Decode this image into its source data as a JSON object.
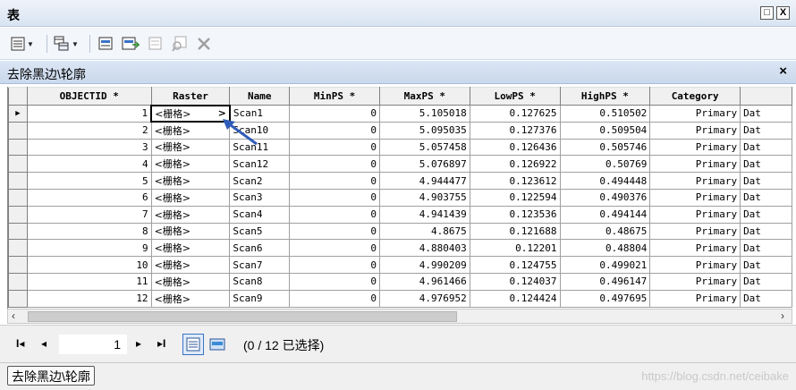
{
  "window": {
    "title": "表",
    "restore_glyph": "□",
    "close_glyph": "X"
  },
  "toolbar": {
    "buttons": [
      "table-options-icon",
      "related-tables-icon",
      "select-by-attributes-icon",
      "switch-selection-icon",
      "clear-selection-icon",
      "zoom-to-selected-icon",
      "delete-selected-icon"
    ]
  },
  "layer_tab": {
    "title": "去除黑边\\轮廓",
    "close_glyph": "×"
  },
  "table": {
    "columns": [
      "OBJECTID *",
      "Raster",
      "Name",
      "MinPS *",
      "MaxPS *",
      "LowPS *",
      "HighPS *",
      "Category",
      ""
    ],
    "rows": [
      [
        "1",
        "<栅格>",
        "Scan1",
        "0",
        "5.105018",
        "0.127625",
        "0.510502",
        "Primary",
        "Dat"
      ],
      [
        "2",
        "<栅格>",
        "Scan10",
        "0",
        "5.095035",
        "0.127376",
        "0.509504",
        "Primary",
        "Dat"
      ],
      [
        "3",
        "<栅格>",
        "Scan11",
        "0",
        "5.057458",
        "0.126436",
        "0.505746",
        "Primary",
        "Dat"
      ],
      [
        "4",
        "<栅格>",
        "Scan12",
        "0",
        "5.076897",
        "0.126922",
        "0.50769",
        "Primary",
        "Dat"
      ],
      [
        "5",
        "<栅格>",
        "Scan2",
        "0",
        "4.944477",
        "0.123612",
        "0.494448",
        "Primary",
        "Dat"
      ],
      [
        "6",
        "<栅格>",
        "Scan3",
        "0",
        "4.903755",
        "0.122594",
        "0.490376",
        "Primary",
        "Dat"
      ],
      [
        "7",
        "<栅格>",
        "Scan4",
        "0",
        "4.941439",
        "0.123536",
        "0.494144",
        "Primary",
        "Dat"
      ],
      [
        "8",
        "<栅格>",
        "Scan5",
        "0",
        "4.8675",
        "0.121688",
        "0.48675",
        "Primary",
        "Dat"
      ],
      [
        "9",
        "<栅格>",
        "Scan6",
        "0",
        "4.880403",
        "0.12201",
        "0.48804",
        "Primary",
        "Dat"
      ],
      [
        "10",
        "<栅格>",
        "Scan7",
        "0",
        "4.990209",
        "0.124755",
        "0.499021",
        "Primary",
        "Dat"
      ],
      [
        "11",
        "<栅格>",
        "Scan8",
        "0",
        "4.961466",
        "0.124037",
        "0.496147",
        "Primary",
        "Dat"
      ],
      [
        "12",
        "<栅格>",
        "Scan9",
        "0",
        "4.976952",
        "0.124424",
        "0.497695",
        "Primary",
        "Dat"
      ]
    ],
    "current_row_marker": "▶",
    "active_cell_arrow": ">"
  },
  "navigation": {
    "first": "I◂",
    "prev": "◂",
    "current_page": "1",
    "next": "▸",
    "last": "▸I",
    "selection_info": "(0 / 12 已选择)"
  },
  "status": {
    "tab_label": "去除黑边\\轮廓",
    "watermark": "https://blog.csdn.net/ceibake"
  }
}
